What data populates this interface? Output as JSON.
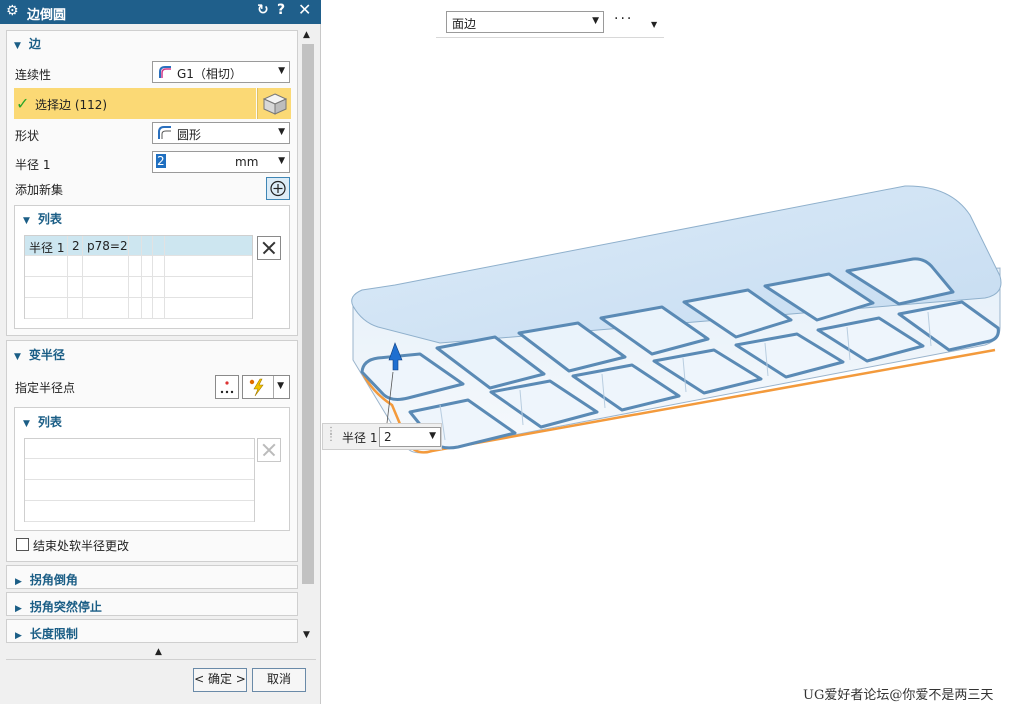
{
  "dialog": {
    "title": "边倒圆",
    "reset_icon": "reset-icon",
    "help_label": "?",
    "close_icon": "close-icon"
  },
  "edge_section": {
    "header": "边",
    "continuity_label": "连续性",
    "continuity_value": "G1（相切）",
    "select_edge_label": "选择边 (112)",
    "shape_label": "形状",
    "shape_value": "圆形",
    "radius_label": "半径 1",
    "radius_value": "2",
    "radius_unit": "mm",
    "add_new_set_label": "添加新集",
    "list_header": "列表",
    "list_rows": [
      {
        "name": "半径 1",
        "value": "2",
        "expr": "p78=2"
      }
    ]
  },
  "variable_radius_section": {
    "header": "变半径",
    "specify_point_label": "指定半径点",
    "list_header": "列表",
    "soft_change_label": "结束处软半径更改",
    "soft_change_checked": false
  },
  "collapsed_sections": [
    "拐角倒角",
    "拐角突然停止",
    "长度限制"
  ],
  "buttons": {
    "ok": "< 确定 >",
    "cancel": "取消"
  },
  "viewport": {
    "filter_value": "面边",
    "more_label": "···",
    "radius_popup_label": "半径 1",
    "radius_popup_value": "2",
    "watermark": "UG爱好者论坛@你爱不是两三天"
  },
  "colors": {
    "title_bar": "#1f5f8b",
    "selection_highlight": "#fbd975",
    "part_face": "#cfe3f5",
    "fillet_edge": "#5a8ab5",
    "bottom_edge": "#f39a3c"
  }
}
